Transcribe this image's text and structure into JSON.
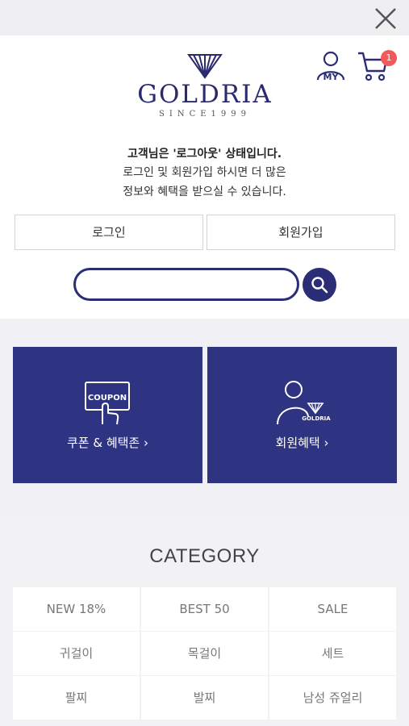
{
  "header": {
    "close_icon": "close-icon",
    "brand": {
      "name": "GOLDRIA",
      "since": "SINCE1999"
    },
    "my_label": "MY",
    "cart_count": "1"
  },
  "notice": {
    "line1": "고객님은 '로그아웃' 상태입니다.",
    "line2": "로그인 및 회원가입 하시면 더 많은",
    "line3": "정보와 혜택을 받으실 수 있습니다."
  },
  "auth": {
    "login_label": "로그인",
    "signup_label": "회원가입"
  },
  "search": {
    "value": "",
    "placeholder": ""
  },
  "promos": {
    "coupon": {
      "icon_text": "COUPON",
      "label": "쿠폰 & 혜택존  ›"
    },
    "benefit": {
      "icon_text": "GOLDRIA",
      "label": "회원혜택  ›"
    }
  },
  "category": {
    "title": "CATEGORY",
    "items": [
      "NEW 18%",
      "BEST 50",
      "SALE",
      "귀걸이",
      "목걸이",
      "세트",
      "팔찌",
      "발찌",
      "남성 쥬얼리"
    ]
  },
  "colors": {
    "brand_navy": "#2e3382",
    "badge_red": "#f05a5a"
  }
}
